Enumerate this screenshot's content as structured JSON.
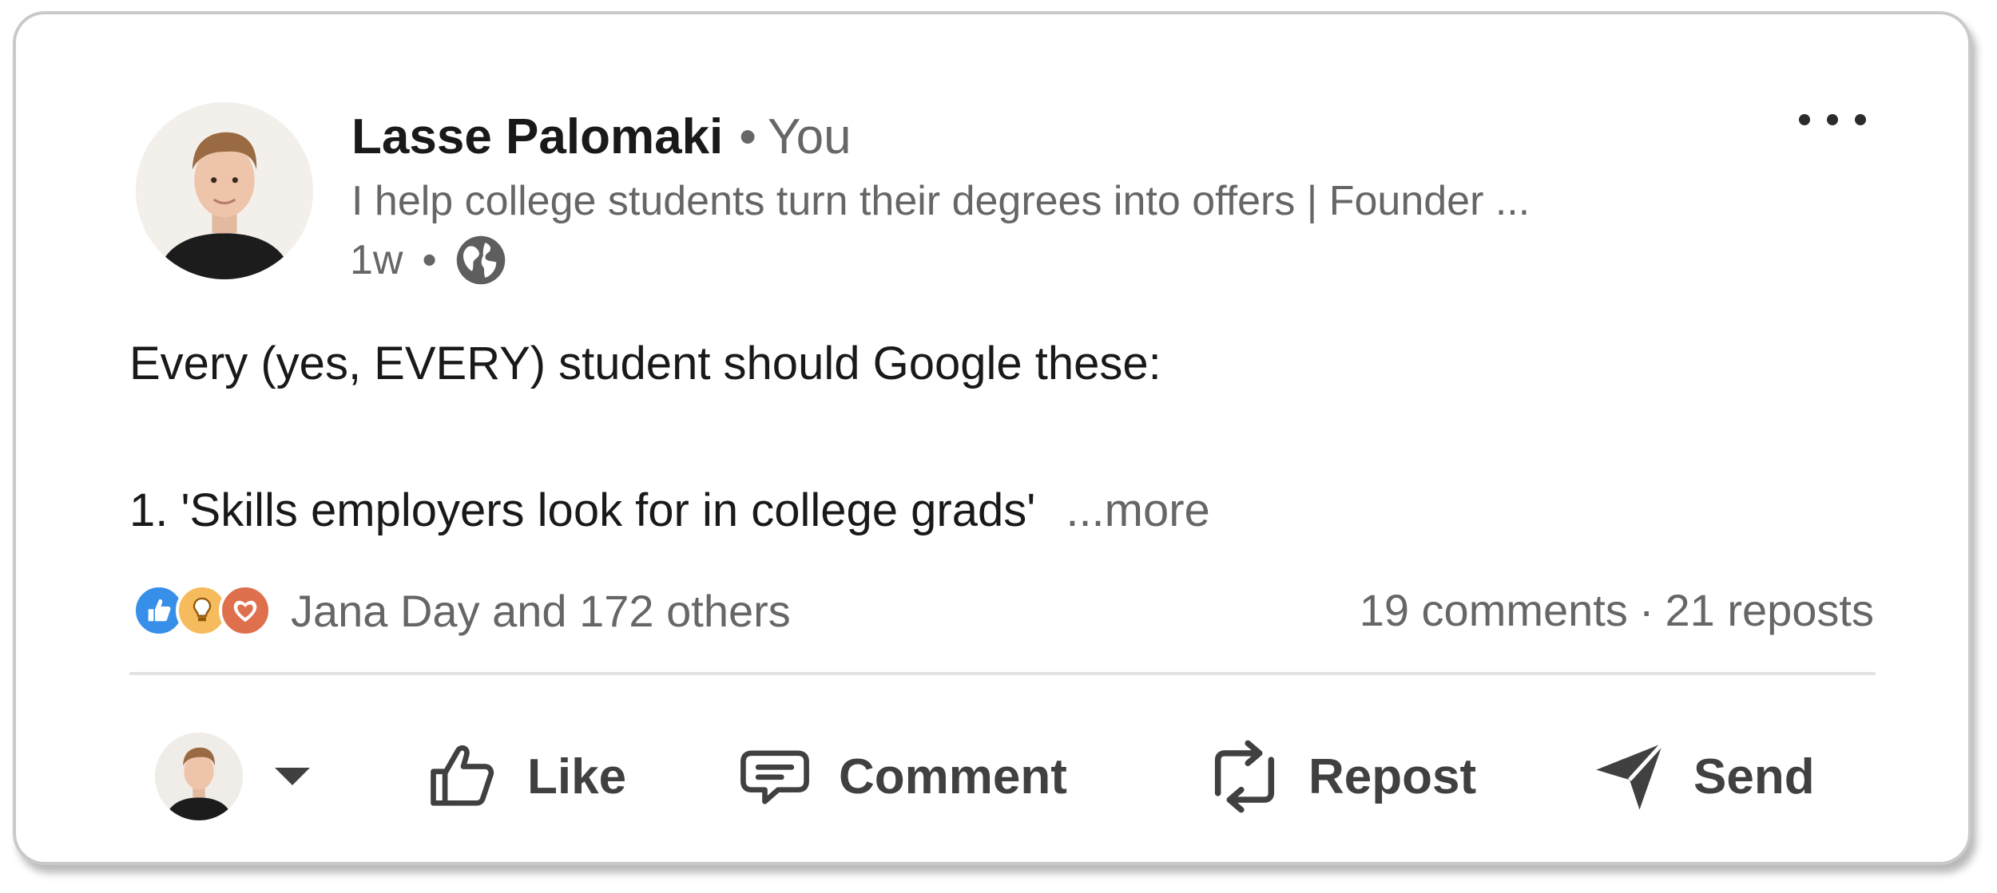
{
  "post": {
    "author": {
      "name": "Lasse Palomaki",
      "degree": "You",
      "headline": "I help college students turn their degrees into offers | Founder ...",
      "time": "1w",
      "visibility_icon": "globe-icon"
    },
    "body": {
      "line1": "Every (yes, EVERY) student should Google these:",
      "line2": "1. 'Skills employers look for in college grads'",
      "more_label": "...more"
    },
    "reactions": {
      "icons": [
        "like-reaction-icon",
        "insightful-reaction-icon",
        "love-reaction-icon"
      ],
      "summary": "Jana Day and 172 others"
    },
    "counts": {
      "comments": "19 comments",
      "separator": "·",
      "reposts": "21 reposts"
    },
    "actions": {
      "like": "Like",
      "comment": "Comment",
      "repost": "Repost",
      "send": "Send"
    },
    "colors": {
      "like_blue": "#378fe9",
      "insightful_yellow": "#f5bb5c",
      "love_red": "#df704d",
      "text_primary": "#191919",
      "text_secondary": "#666666",
      "action_gray": "#404040"
    }
  }
}
